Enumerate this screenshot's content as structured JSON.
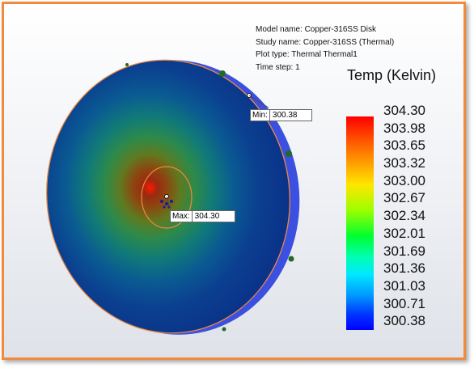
{
  "study_info": {
    "model_name": "Model name: Copper-316SS Disk",
    "study_name": "Study name: Copper-316SS (Thermal)",
    "plot_type": "Plot type: Thermal Thermal1",
    "time_step": "Time step: 1"
  },
  "legend": {
    "title": "Temp (Kelvin)",
    "ticks": [
      "304.30",
      "303.98",
      "303.65",
      "303.32",
      "303.00",
      "302.67",
      "302.34",
      "302.01",
      "301.69",
      "301.36",
      "301.03",
      "300.71",
      "300.38"
    ]
  },
  "min_probe": {
    "label": "Min:",
    "value": "300.38"
  },
  "max_probe": {
    "label": "Max:",
    "value": "304.30"
  },
  "colors": {
    "frame_border": "#f08a3e",
    "disk_edge": "#3b4fe0",
    "outline": "#f08a3e",
    "fixture_markers": "#1f6b1f"
  }
}
